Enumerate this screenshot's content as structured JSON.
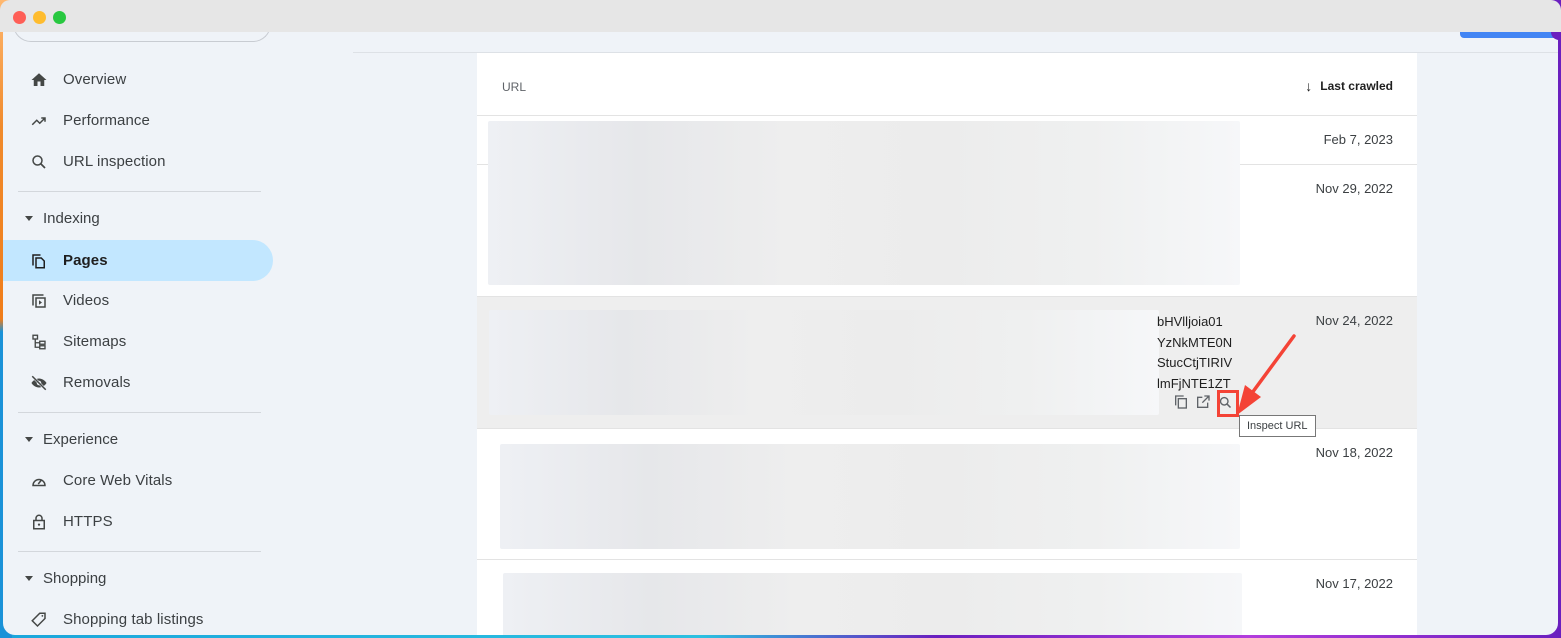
{
  "window": {
    "traffic_lights": [
      "close",
      "minimize",
      "maximize"
    ]
  },
  "sidebar": {
    "top_items": [
      {
        "label": "Overview",
        "icon": "home-icon"
      },
      {
        "label": "Performance",
        "icon": "trending-up-icon"
      },
      {
        "label": "URL inspection",
        "icon": "search-icon"
      }
    ],
    "sections": [
      {
        "label": "Indexing",
        "items": [
          {
            "label": "Pages",
            "icon": "pages-icon",
            "active": true
          },
          {
            "label": "Videos",
            "icon": "video-library-icon"
          },
          {
            "label": "Sitemaps",
            "icon": "sitemap-icon"
          },
          {
            "label": "Removals",
            "icon": "visibility-off-icon"
          }
        ]
      },
      {
        "label": "Experience",
        "items": [
          {
            "label": "Core Web Vitals",
            "icon": "speed-gauge-icon"
          },
          {
            "label": "HTTPS",
            "icon": "lock-icon"
          }
        ]
      },
      {
        "label": "Shopping",
        "items": [
          {
            "label": "Shopping tab listings",
            "icon": "tag-icon"
          }
        ]
      }
    ]
  },
  "table": {
    "columns": {
      "url": "URL",
      "last_crawled": "Last crawled",
      "sort_direction": "descending"
    },
    "rows": [
      {
        "url_visible": [],
        "last_crawled": "Feb 7, 2023"
      },
      {
        "url_visible": [],
        "last_crawled": "Nov 29, 2022"
      },
      {
        "url_visible": [
          "bHVlljoia01",
          "YzNkMTE0N",
          "StucCtjTIRIV",
          "lmFjNTE1ZT"
        ],
        "last_crawled": "Nov 24, 2022",
        "hovered": true
      },
      {
        "url_visible": [],
        "last_crawled": "Nov 18, 2022"
      },
      {
        "url_visible": [],
        "last_crawled": "Nov 17, 2022"
      }
    ],
    "row_actions": {
      "copy": "copy-icon",
      "open": "open-in-new-icon",
      "inspect": "inspect-url-icon"
    },
    "tooltip": "Inspect URL"
  },
  "annotation": {
    "color": "#f44336",
    "target": "Inspect URL"
  }
}
